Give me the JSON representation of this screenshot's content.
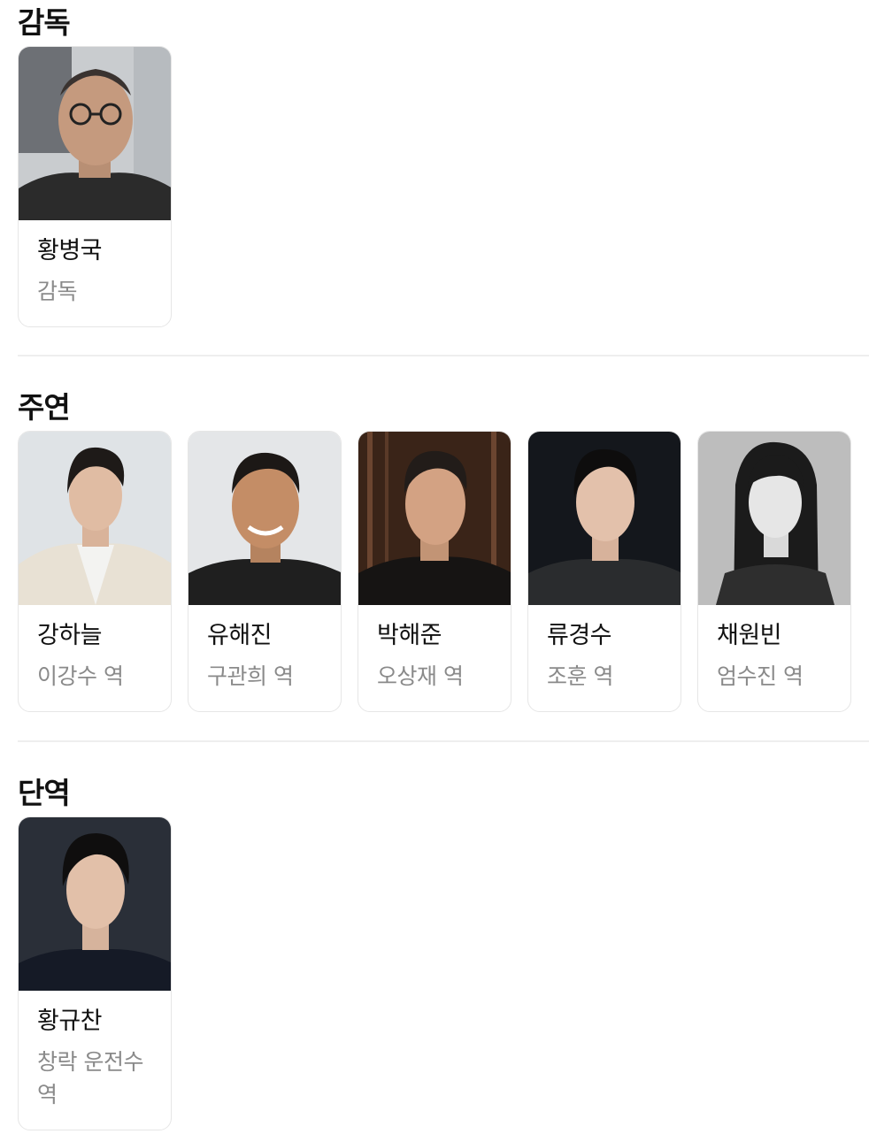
{
  "sections": [
    {
      "title": "감독",
      "people": [
        {
          "name": "황병국",
          "role": "감독"
        }
      ]
    },
    {
      "title": "주연",
      "people": [
        {
          "name": "강하늘",
          "role": "이강수 역"
        },
        {
          "name": "유해진",
          "role": "구관희 역"
        },
        {
          "name": "박해준",
          "role": "오상재 역"
        },
        {
          "name": "류경수",
          "role": "조훈 역"
        },
        {
          "name": "채원빈",
          "role": "엄수진 역"
        }
      ]
    },
    {
      "title": "단역",
      "people": [
        {
          "name": "황규찬",
          "role": "창락 운전수 역"
        }
      ]
    }
  ],
  "colors": {
    "title": "#111111",
    "role": "#8a8a8a",
    "border": "#e6e6e6",
    "divider": "#eeeeee"
  }
}
